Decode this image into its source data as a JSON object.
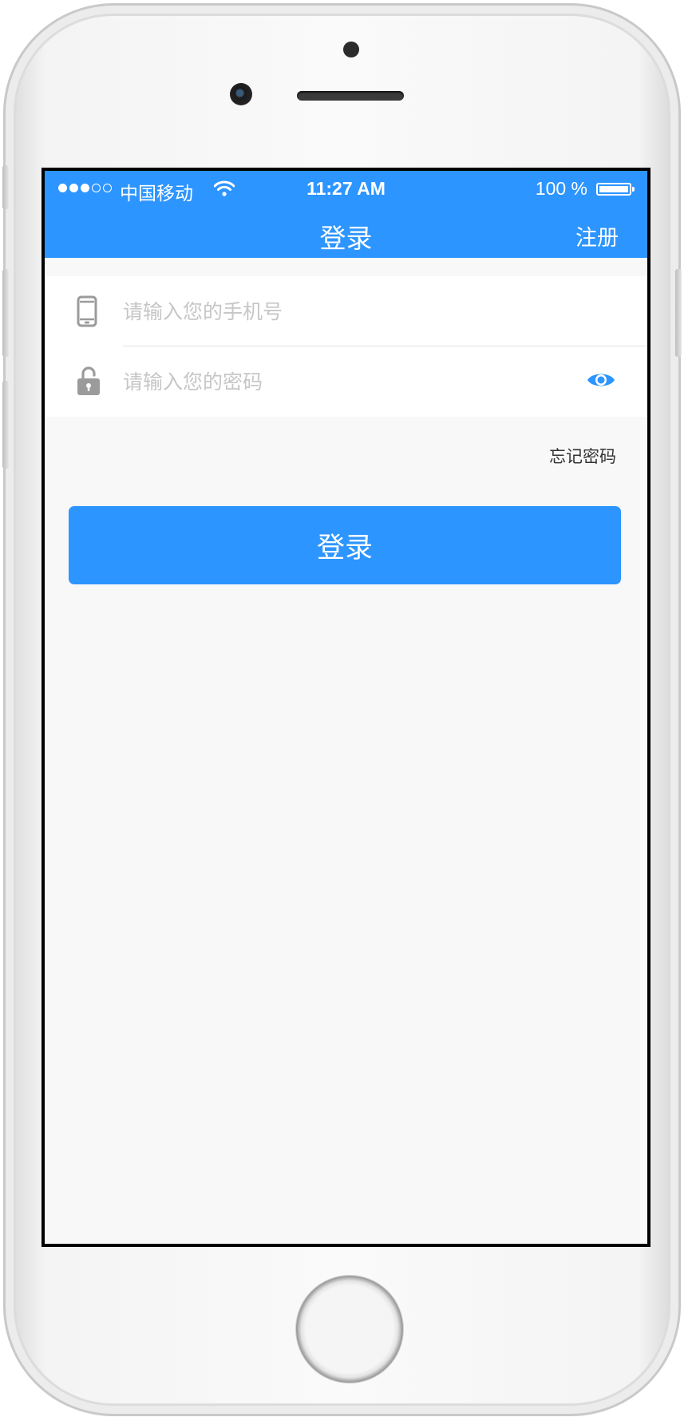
{
  "status_bar": {
    "carrier": "中国移动",
    "time": "11:27 AM",
    "battery_percent": "100 %",
    "signal_bars_filled": 3,
    "signal_bars_total": 5
  },
  "nav": {
    "title": "登录",
    "register_label": "注册"
  },
  "form": {
    "phone_placeholder": "请输入您的手机号",
    "password_placeholder": "请输入您的密码",
    "phone_icon": "phone-icon",
    "lock_icon": "unlock-icon",
    "toggle_icon": "eye-icon"
  },
  "forgot_password_label": "忘记密码",
  "login_button_label": "登录",
  "colors": {
    "accent": "#2d95ff",
    "background": "#f8f8f8",
    "icon_gray": "#9b9b9b"
  }
}
